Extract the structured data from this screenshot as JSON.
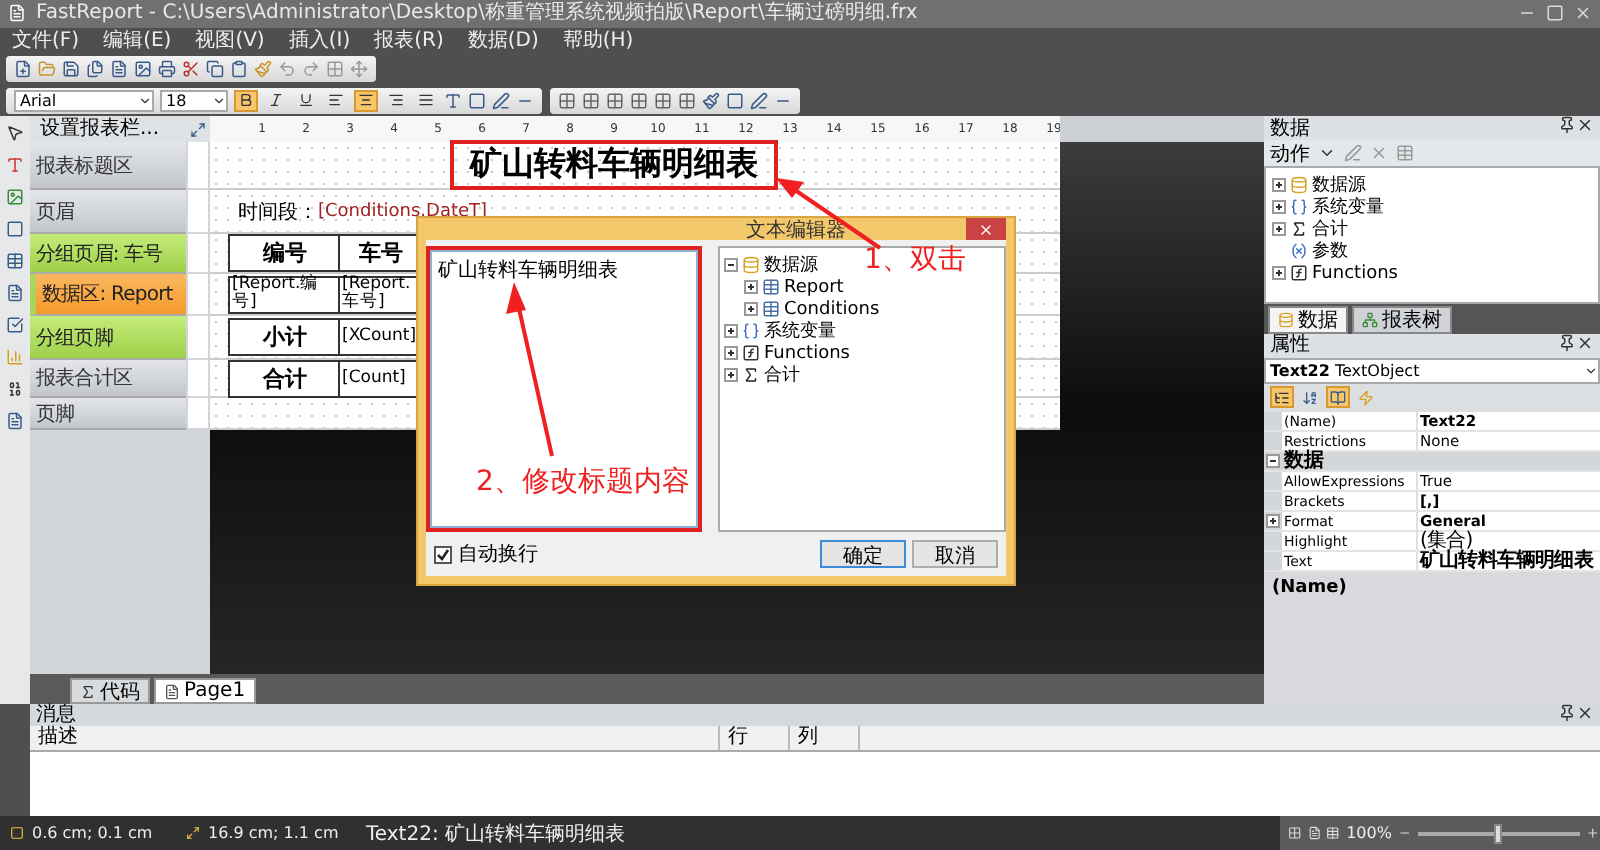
{
  "window": {
    "title": "FastReport - C:\\Users\\Administrator\\Desktop\\称重管理系统视频拍版\\Report\\车辆过磅明细.frx"
  },
  "menu": [
    "文件(F)",
    "编辑(E)",
    "视图(V)",
    "插入(I)",
    "报表(R)",
    "数据(D)",
    "帮助(H)"
  ],
  "toolbar2": {
    "font": "Arial",
    "size": "18",
    "bold": true,
    "align_center": true
  },
  "band_panel": {
    "header": "设置报表栏...",
    "bands": [
      {
        "label": "报表标题区",
        "kind": "plain"
      },
      {
        "label": "页眉",
        "kind": "plain"
      },
      {
        "label": "分组页眉: 车号",
        "kind": "group"
      },
      {
        "label": "数据区: Report",
        "kind": "data"
      },
      {
        "label": "分组页脚",
        "kind": "group"
      },
      {
        "label": "报表合计区",
        "kind": "plain"
      },
      {
        "label": "页脚",
        "kind": "plain"
      }
    ]
  },
  "ruler": [
    "1",
    "2",
    "3",
    "4",
    "5",
    "6",
    "7",
    "8",
    "9",
    "10",
    "11",
    "12",
    "13",
    "14",
    "15",
    "16",
    "17",
    "18",
    "19"
  ],
  "report_page": {
    "title": "矿山转料车辆明细表",
    "period_label": "时间段：",
    "period_field": "[Conditions.DateT]",
    "table": [
      {
        "cells": [
          {
            "text": "编号",
            "kind": "head"
          },
          {
            "text": "车号",
            "kind": "head"
          }
        ]
      },
      {
        "cells": [
          {
            "text": "[Report.编号]",
            "kind": "field"
          },
          {
            "text": "[Report.车号]",
            "kind": "field"
          }
        ]
      },
      {
        "cells": [
          {
            "text": "小计",
            "kind": "head"
          },
          {
            "text": "[XCount]",
            "kind": "field"
          }
        ]
      },
      {
        "cells": [
          {
            "text": "合计",
            "kind": "head"
          },
          {
            "text": "[Count]",
            "kind": "field"
          }
        ]
      }
    ]
  },
  "dialog": {
    "title": "文本编辑器",
    "text": "矿山转料车辆明细表",
    "tree": [
      {
        "label": "数据源",
        "kind": "datasource",
        "expanded": true,
        "children": [
          {
            "label": "Report",
            "kind": "table",
            "expanded": false
          },
          {
            "label": "Conditions",
            "kind": "table",
            "expanded": false
          }
        ]
      },
      {
        "label": "系统变量",
        "kind": "variables",
        "expanded": false
      },
      {
        "label": "Functions",
        "kind": "functions",
        "expanded": false
      },
      {
        "label": "合计",
        "kind": "total",
        "expanded": false
      }
    ],
    "word_wrap": {
      "label": "自动换行",
      "checked": true
    },
    "buttons": [
      "确定",
      "取消"
    ]
  },
  "annotations": [
    "1、双击",
    "2、修改标题内容"
  ],
  "data_panel": {
    "title": "数据",
    "action": "动作",
    "tree": [
      {
        "label": "数据源",
        "kind": "datasource",
        "expanded": false
      },
      {
        "label": "系统变量",
        "kind": "variables",
        "expanded": false
      },
      {
        "label": "合计",
        "kind": "total",
        "expanded": false
      },
      {
        "label": "参数",
        "kind": "parameters"
      },
      {
        "label": "Functions",
        "kind": "functions",
        "expanded": false
      }
    ]
  },
  "right_tabs": [
    {
      "label": "数据",
      "selected": true
    },
    {
      "label": "报表树",
      "selected": false
    }
  ],
  "properties": {
    "title": "属性",
    "object_name": "Text22",
    "object_type": "TextObject",
    "rows": [
      {
        "kind": "row",
        "name": "(Name)",
        "value": "Text22",
        "bold": true
      },
      {
        "kind": "row",
        "name": "Restrictions",
        "value": "None",
        "bold": false
      },
      {
        "kind": "category",
        "name": "数据",
        "expanded": true
      },
      {
        "kind": "row",
        "name": "AllowExpressions",
        "value": "True",
        "bold": false
      },
      {
        "kind": "row",
        "name": "Brackets",
        "value": "[,]",
        "bold": true
      },
      {
        "kind": "row",
        "name": "Format",
        "value": "General",
        "bold": true,
        "expanded": false
      },
      {
        "kind": "row",
        "name": "Highlight",
        "value": "(集合)",
        "bold": false
      },
      {
        "kind": "row",
        "name": "Text",
        "value": "矿山转料车辆明细表",
        "bold": true
      }
    ],
    "description": "(Name)"
  },
  "page_tabs": [
    {
      "label": "代码",
      "selected": false
    },
    {
      "label": "Page1",
      "selected": true
    }
  ],
  "messages": {
    "title": "消息",
    "columns": [
      "描述",
      "行",
      "列"
    ]
  },
  "status_bar": {
    "position": "0.6 cm; 0.1 cm",
    "size": "16.9 cm; 1.1 cm",
    "object": "Text22:  矿山转料车辆明细表",
    "zoom": "100%",
    "zoom_slider": {
      "level": 0.5
    }
  }
}
